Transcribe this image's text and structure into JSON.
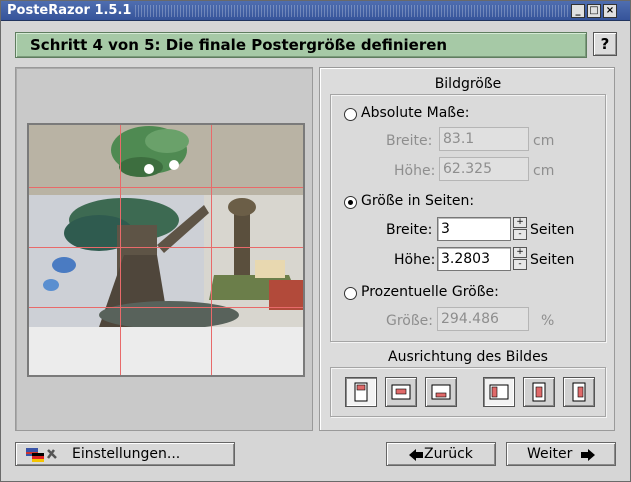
{
  "window": {
    "title": "PosteRazor 1.5.1",
    "controls": [
      "_",
      "□",
      "×"
    ]
  },
  "header": {
    "step_title": "Schritt 4 von 5: Die finale Postergröße definieren",
    "help_label": "?"
  },
  "image_size": {
    "group_title": "Bildgröße",
    "absolute": {
      "label": "Absolute Maße:",
      "selected": false,
      "width_label": "Breite:",
      "width_value": "83.1",
      "width_unit": "cm",
      "height_label": "Höhe:",
      "height_value": "62.325",
      "height_unit": "cm"
    },
    "pages": {
      "label": "Größe in Seiten:",
      "selected": true,
      "width_label": "Breite:",
      "width_value": "3",
      "width_unit": "Seiten",
      "height_label": "Höhe:",
      "height_value": "3.2803",
      "height_unit": "Seiten"
    },
    "percent": {
      "label": "Prozentuelle Größe:",
      "selected": false,
      "size_label": "Größe:",
      "size_value": "294.486",
      "size_unit": "%"
    }
  },
  "alignment": {
    "group_title": "Ausrichtung des Bildes",
    "buttons": [
      "align-top",
      "align-center-vertical",
      "align-bottom",
      "align-left",
      "align-center-horizontal",
      "align-right"
    ],
    "selected": [
      "align-top",
      "align-left"
    ]
  },
  "footer": {
    "settings_label": "Einstellungen...",
    "back_label": "Zurück",
    "next_label": "Weiter"
  },
  "colors": {
    "header_bg": "#a6c9a6",
    "titlebar_bg": "#3f5ea6",
    "page_grid": "#e86a6a"
  }
}
